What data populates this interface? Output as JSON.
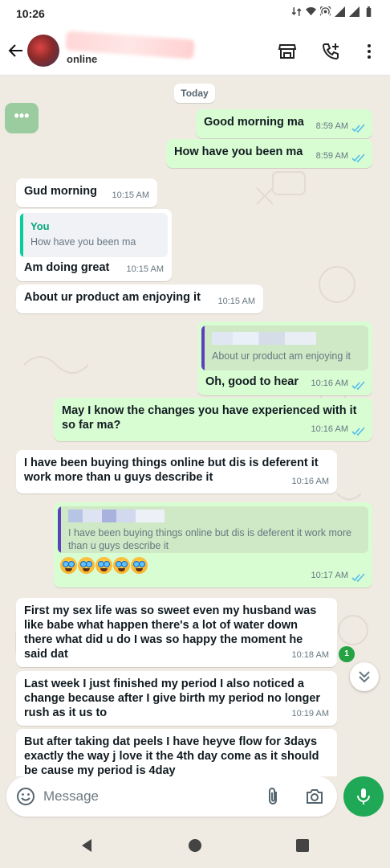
{
  "status_bar": {
    "time": "10:26"
  },
  "header": {
    "contact_status": "online",
    "icons": [
      "back-arrow-icon",
      "store-icon",
      "add-call-icon",
      "more-vert-icon"
    ]
  },
  "chat": {
    "date_label": "Today",
    "more_label": "•••",
    "messages": [
      {
        "dir": "out",
        "text": "Good morning ma",
        "time": "8:59 AM",
        "read": true
      },
      {
        "dir": "out",
        "text": "How have you been ma",
        "time": "8:59 AM",
        "read": true
      },
      {
        "dir": "in",
        "text": "Gud morning",
        "time": "10:15 AM"
      },
      {
        "dir": "in",
        "quote_name": "You",
        "quote_text": "How have you been ma",
        "text": "Am doing great",
        "time": "10:15 AM"
      },
      {
        "dir": "in",
        "text": "About ur product am enjoying it",
        "time": "10:15 AM"
      },
      {
        "dir": "out",
        "quote_text": "About ur product am enjoying it",
        "text": "Oh, good to hear",
        "time": "10:16 AM",
        "read": true
      },
      {
        "dir": "out",
        "text": "May I know the changes you have experienced with it so far ma?",
        "time": "10:16 AM",
        "read": true
      },
      {
        "dir": "in",
        "text": "I have been buying things online but dis is deferent  it work more than u guys describe it",
        "time": "10:16 AM"
      },
      {
        "dir": "out",
        "quote_text": "I have been buying things online but dis is deferent  it work more than u guys describe it",
        "text": "🤩🤩🤩🤩🤩",
        "time": "10:17 AM",
        "read": true
      },
      {
        "dir": "in",
        "text": "First my sex life was so sweet even my husband was like babe what happen there's a lot of water down there what did u do I was so happy the moment he said dat",
        "time": "10:18 AM"
      },
      {
        "dir": "in",
        "text": "Last week I just finished my period I also noticed a change because after I give birth my period no longer rush as it us to",
        "time": "10:19 AM"
      },
      {
        "dir": "in",
        "text": "But after taking dat peels   I have heyve flow for 3days exactly the way j love it the 4th day come as it should be cause my period is 4day"
      }
    ],
    "unread_count": "1"
  },
  "composer": {
    "placeholder": "Message"
  },
  "colors": {
    "accent": "#1fa855",
    "outgoing_bubble": "#d9fdd3",
    "incoming_bubble": "#ffffff",
    "tick_blue": "#53bdeb",
    "quote_green": "#06cf9c",
    "quote_purple": "#5e3fbe"
  }
}
